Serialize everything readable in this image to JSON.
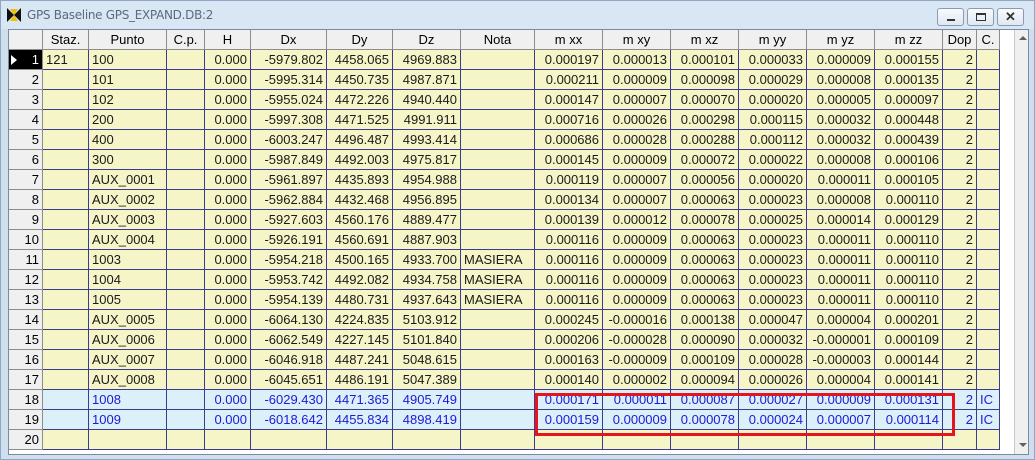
{
  "window": {
    "title": "GPS Baseline GPS_EXPAND.DB:2",
    "buttons": [
      "minimize",
      "maximize",
      "close"
    ]
  },
  "table": {
    "columns": [
      "",
      "Staz.",
      "Punto",
      "C.p.",
      "H",
      "Dx",
      "Dy",
      "Dz",
      "Nota",
      "m xx",
      "m xy",
      "m xz",
      "m yy",
      "m yz",
      "m zz",
      "Dop",
      "C."
    ],
    "rows": [
      {
        "n": "1",
        "staz": "121",
        "punto": "100",
        "cp": "",
        "h": "0.000",
        "dx": "-5979.802",
        "dy": "4458.065",
        "dz": "4969.883",
        "nota": "",
        "mxx": "0.000197",
        "mxy": "0.000013",
        "mxz": "0.000101",
        "myy": "0.000033",
        "myz": "0.000009",
        "mzz": "0.000155",
        "dop": "2",
        "c": "",
        "style": "yellow"
      },
      {
        "n": "2",
        "staz": "",
        "punto": "101",
        "cp": "",
        "h": "0.000",
        "dx": "-5995.314",
        "dy": "4450.735",
        "dz": "4987.871",
        "nota": "",
        "mxx": "0.000211",
        "mxy": "0.000009",
        "mxz": "0.000098",
        "myy": "0.000029",
        "myz": "0.000008",
        "mzz": "0.000135",
        "dop": "2",
        "c": "",
        "style": "yellow"
      },
      {
        "n": "3",
        "staz": "",
        "punto": "102",
        "cp": "",
        "h": "0.000",
        "dx": "-5955.024",
        "dy": "4472.226",
        "dz": "4940.440",
        "nota": "",
        "mxx": "0.000147",
        "mxy": "0.000007",
        "mxz": "0.000070",
        "myy": "0.000020",
        "myz": "0.000005",
        "mzz": "0.000097",
        "dop": "2",
        "c": "",
        "style": "yellow"
      },
      {
        "n": "4",
        "staz": "",
        "punto": "200",
        "cp": "",
        "h": "0.000",
        "dx": "-5997.308",
        "dy": "4471.525",
        "dz": "4991.911",
        "nota": "",
        "mxx": "0.000716",
        "mxy": "0.000026",
        "mxz": "0.000298",
        "myy": "0.000115",
        "myz": "0.000032",
        "mzz": "0.000448",
        "dop": "2",
        "c": "",
        "style": "yellow"
      },
      {
        "n": "5",
        "staz": "",
        "punto": "400",
        "cp": "",
        "h": "0.000",
        "dx": "-6003.247",
        "dy": "4496.487",
        "dz": "4993.414",
        "nota": "",
        "mxx": "0.000686",
        "mxy": "0.000028",
        "mxz": "0.000288",
        "myy": "0.000112",
        "myz": "0.000032",
        "mzz": "0.000439",
        "dop": "2",
        "c": "",
        "style": "yellow"
      },
      {
        "n": "6",
        "staz": "",
        "punto": "300",
        "cp": "",
        "h": "0.000",
        "dx": "-5987.849",
        "dy": "4492.003",
        "dz": "4975.817",
        "nota": "",
        "mxx": "0.000145",
        "mxy": "0.000009",
        "mxz": "0.000072",
        "myy": "0.000022",
        "myz": "0.000008",
        "mzz": "0.000106",
        "dop": "2",
        "c": "",
        "style": "yellow"
      },
      {
        "n": "7",
        "staz": "",
        "punto": "AUX_0001",
        "cp": "",
        "h": "0.000",
        "dx": "-5961.897",
        "dy": "4435.893",
        "dz": "4954.988",
        "nota": "",
        "mxx": "0.000119",
        "mxy": "0.000007",
        "mxz": "0.000056",
        "myy": "0.000020",
        "myz": "0.000011",
        "mzz": "0.000105",
        "dop": "2",
        "c": "",
        "style": "yellow"
      },
      {
        "n": "8",
        "staz": "",
        "punto": "AUX_0002",
        "cp": "",
        "h": "0.000",
        "dx": "-5962.884",
        "dy": "4432.468",
        "dz": "4956.895",
        "nota": "",
        "mxx": "0.000134",
        "mxy": "0.000007",
        "mxz": "0.000063",
        "myy": "0.000023",
        "myz": "0.000008",
        "mzz": "0.000110",
        "dop": "2",
        "c": "",
        "style": "yellow"
      },
      {
        "n": "9",
        "staz": "",
        "punto": "AUX_0003",
        "cp": "",
        "h": "0.000",
        "dx": "-5927.603",
        "dy": "4560.176",
        "dz": "4889.477",
        "nota": "",
        "mxx": "0.000139",
        "mxy": "0.000012",
        "mxz": "0.000078",
        "myy": "0.000025",
        "myz": "0.000014",
        "mzz": "0.000129",
        "dop": "2",
        "c": "",
        "style": "yellow"
      },
      {
        "n": "10",
        "staz": "",
        "punto": "AUX_0004",
        "cp": "",
        "h": "0.000",
        "dx": "-5926.191",
        "dy": "4560.691",
        "dz": "4887.903",
        "nota": "",
        "mxx": "0.000116",
        "mxy": "0.000009",
        "mxz": "0.000063",
        "myy": "0.000023",
        "myz": "0.000011",
        "mzz": "0.000110",
        "dop": "2",
        "c": "",
        "style": "yellow"
      },
      {
        "n": "11",
        "staz": "",
        "punto": "1003",
        "cp": "",
        "h": "0.000",
        "dx": "-5954.218",
        "dy": "4500.165",
        "dz": "4933.700",
        "nota": "MASIERA",
        "mxx": "0.000116",
        "mxy": "0.000009",
        "mxz": "0.000063",
        "myy": "0.000023",
        "myz": "0.000011",
        "mzz": "0.000110",
        "dop": "2",
        "c": "",
        "style": "yellow"
      },
      {
        "n": "12",
        "staz": "",
        "punto": "1004",
        "cp": "",
        "h": "0.000",
        "dx": "-5953.742",
        "dy": "4492.082",
        "dz": "4934.758",
        "nota": "MASIERA",
        "mxx": "0.000116",
        "mxy": "0.000009",
        "mxz": "0.000063",
        "myy": "0.000023",
        "myz": "0.000011",
        "mzz": "0.000110",
        "dop": "2",
        "c": "",
        "style": "yellow"
      },
      {
        "n": "13",
        "staz": "",
        "punto": "1005",
        "cp": "",
        "h": "0.000",
        "dx": "-5954.139",
        "dy": "4480.731",
        "dz": "4937.643",
        "nota": "MASIERA",
        "mxx": "0.000116",
        "mxy": "0.000009",
        "mxz": "0.000063",
        "myy": "0.000023",
        "myz": "0.000011",
        "mzz": "0.000110",
        "dop": "2",
        "c": "",
        "style": "yellow"
      },
      {
        "n": "14",
        "staz": "",
        "punto": "AUX_0005",
        "cp": "",
        "h": "0.000",
        "dx": "-6064.130",
        "dy": "4224.835",
        "dz": "5103.912",
        "nota": "",
        "mxx": "0.000245",
        "mxy": "-0.000016",
        "mxz": "0.000138",
        "myy": "0.000047",
        "myz": "0.000004",
        "mzz": "0.000201",
        "dop": "2",
        "c": "",
        "style": "yellow"
      },
      {
        "n": "15",
        "staz": "",
        "punto": "AUX_0006",
        "cp": "",
        "h": "0.000",
        "dx": "-6062.549",
        "dy": "4227.145",
        "dz": "5101.840",
        "nota": "",
        "mxx": "0.000206",
        "mxy": "-0.000028",
        "mxz": "0.000090",
        "myy": "0.000032",
        "myz": "-0.000001",
        "mzz": "0.000109",
        "dop": "2",
        "c": "",
        "style": "yellow"
      },
      {
        "n": "16",
        "staz": "",
        "punto": "AUX_0007",
        "cp": "",
        "h": "0.000",
        "dx": "-6046.918",
        "dy": "4487.241",
        "dz": "5048.615",
        "nota": "",
        "mxx": "0.000163",
        "mxy": "-0.000009",
        "mxz": "0.000109",
        "myy": "0.000028",
        "myz": "-0.000003",
        "mzz": "0.000144",
        "dop": "2",
        "c": "",
        "style": "yellow"
      },
      {
        "n": "17",
        "staz": "",
        "punto": "AUX_0008",
        "cp": "",
        "h": "0.000",
        "dx": "-6045.651",
        "dy": "4486.191",
        "dz": "5047.389",
        "nota": "",
        "mxx": "0.000140",
        "mxy": "0.000002",
        "mxz": "0.000094",
        "myy": "0.000026",
        "myz": "0.000004",
        "mzz": "0.000141",
        "dop": "2",
        "c": "",
        "style": "yellow"
      },
      {
        "n": "18",
        "staz": "",
        "punto": "1008",
        "cp": "",
        "h": "0.000",
        "dx": "-6029.430",
        "dy": "4471.365",
        "dz": "4905.749",
        "nota": "",
        "mxx": "0.000171",
        "mxy": "0.000011",
        "mxz": "0.000087",
        "myy": "0.000027",
        "myz": "0.000009",
        "mzz": "0.000131",
        "dop": "2",
        "c": "IC",
        "style": "blue"
      },
      {
        "n": "19",
        "staz": "",
        "punto": "1009",
        "cp": "",
        "h": "0.000",
        "dx": "-6018.642",
        "dy": "4455.834",
        "dz": "4898.419",
        "nota": "",
        "mxx": "0.000159",
        "mxy": "0.000009",
        "mxz": "0.000078",
        "myy": "0.000024",
        "myz": "0.000007",
        "mzz": "0.000114",
        "dop": "2",
        "c": "IC",
        "style": "blue"
      },
      {
        "n": "20",
        "staz": "",
        "punto": "",
        "cp": "",
        "h": "",
        "dx": "",
        "dy": "",
        "dz": "",
        "nota": "",
        "mxx": "",
        "mxy": "",
        "mxz": "",
        "myy": "",
        "myz": "",
        "mzz": "",
        "dop": "",
        "c": "",
        "style": "yellow"
      }
    ],
    "active_row": "1",
    "highlighted_rows": [
      "18",
      "19"
    ],
    "highlight_color": "#e8141c"
  },
  "colors": {
    "row_yellow": "#f5f5c8",
    "row_blue": "#dcf0fa",
    "blue_text": "#1a1ad8"
  }
}
